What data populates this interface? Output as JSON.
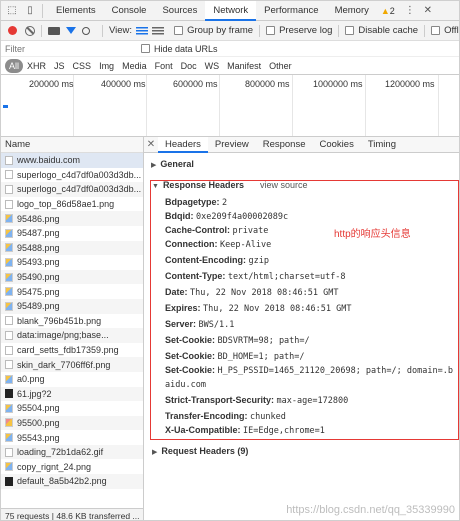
{
  "top_tabs": [
    "Elements",
    "Console",
    "Sources",
    "Network",
    "Performance",
    "Memory"
  ],
  "warning_count": "2",
  "overflow_label": "Offli",
  "toolbar": {
    "view_label": "View:",
    "group_by_frame": "Group by frame",
    "preserve_log": "Preserve log",
    "disable_cache": "Disable cache"
  },
  "filter": {
    "placeholder": "Filter",
    "hide_data_urls": "Hide data URLs"
  },
  "type_filters": [
    "All",
    "XHR",
    "JS",
    "CSS",
    "Img",
    "Media",
    "Font",
    "Doc",
    "WS",
    "Manifest",
    "Other"
  ],
  "timeline_ticks": [
    "200000 ms",
    "400000 ms",
    "600000 ms",
    "800000 ms",
    "1000000 ms",
    "1200000 ms"
  ],
  "list": {
    "header": "Name",
    "items": [
      "www.baidu.com",
      "superlogo_c4d7df0a003d3db...",
      "superlogo_c4d7df0a003d3db...",
      "logo_top_86d58ae1.png",
      "95486.png",
      "95487.png",
      "95488.png",
      "95493.png",
      "95490.png",
      "95475.png",
      "95489.png",
      "blank_796b451b.png",
      "data:image/png;base...",
      "card_setts_fdb17359.png",
      "skin_dark_7706ff6f.png",
      "a0.png",
      "61.jpg?2",
      "95504.png",
      "95500.png",
      "95543.png",
      "loading_72b1da62.gif",
      "copy_rignt_24.png",
      "default_8a5b42b2.png"
    ],
    "status": "75 requests | 48.6 KB transferred ..."
  },
  "detail_tabs": [
    "Headers",
    "Preview",
    "Response",
    "Cookies",
    "Timing"
  ],
  "general_label": "General",
  "response_headers_label": "Response Headers",
  "view_source_label": "view source",
  "annotation": "http的响应头信息",
  "response_headers": [
    {
      "k": "Bdpagetype:",
      "v": "2"
    },
    {
      "k": "Bdqid:",
      "v": "0xe209f4a00002089c"
    },
    {
      "k": "Cache-Control:",
      "v": "private"
    },
    {
      "k": "Connection:",
      "v": "Keep-Alive"
    },
    {
      "k": "Content-Encoding:",
      "v": "gzip"
    },
    {
      "k": "Content-Type:",
      "v": "text/html;charset=utf-8"
    },
    {
      "k": "Date:",
      "v": "Thu, 22 Nov 2018 08:46:51 GMT"
    },
    {
      "k": "Expires:",
      "v": "Thu, 22 Nov 2018 08:46:51 GMT"
    },
    {
      "k": "Server:",
      "v": "BWS/1.1"
    },
    {
      "k": "Set-Cookie:",
      "v": "BDSVRTM=98; path=/"
    },
    {
      "k": "Set-Cookie:",
      "v": "BD_HOME=1; path=/"
    },
    {
      "k": "Set-Cookie:",
      "v": "H_PS_PSSID=1465_21120_20698; path=/; domain=.b"
    },
    {
      "k": "",
      "v": "aidu.com"
    },
    {
      "k": "Strict-Transport-Security:",
      "v": "max-age=172800"
    },
    {
      "k": "Transfer-Encoding:",
      "v": "chunked"
    },
    {
      "k": "X-Ua-Compatible:",
      "v": "IE=Edge,chrome=1"
    }
  ],
  "request_headers_label": "Request Headers (9)",
  "watermark": "https://blog.csdn.net/qq_35339990"
}
